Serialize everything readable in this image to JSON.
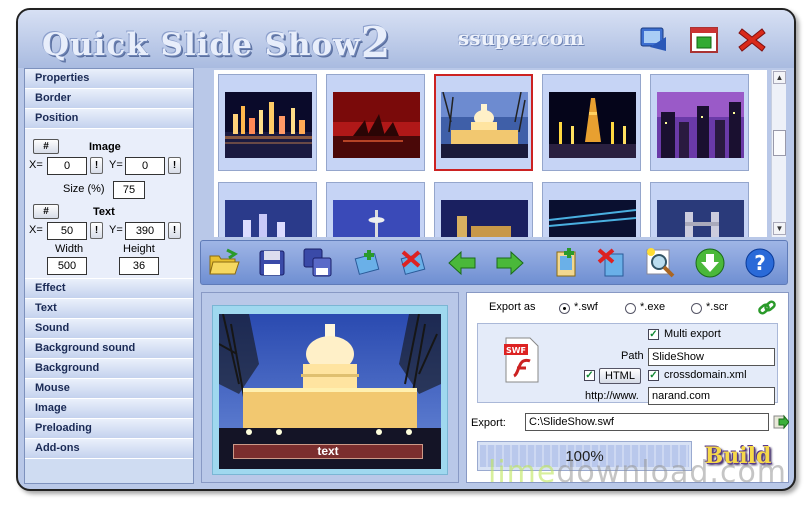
{
  "title": {
    "main": "Quick Slide Show",
    "version": "2",
    "site": "ssuper.com"
  },
  "sidebar": {
    "top_items": [
      {
        "label": "Properties"
      },
      {
        "label": "Border"
      },
      {
        "label": "Position"
      }
    ],
    "position_panel": {
      "image_title": "Image",
      "hash_label": "#",
      "x_label": "X=",
      "y_label": "Y=",
      "image_x": "0",
      "image_y": "0",
      "size_label": "Size (%)",
      "size_value": "75",
      "text_title": "Text",
      "text_x": "50",
      "text_y": "390",
      "width_label": "Width",
      "height_label": "Height",
      "width_value": "500",
      "height_value": "36",
      "excl": "!"
    },
    "bottom_items": [
      {
        "label": "Effect"
      },
      {
        "label": "Text"
      },
      {
        "label": "Sound"
      },
      {
        "label": "Background sound"
      },
      {
        "label": "Background"
      },
      {
        "label": "Mouse"
      },
      {
        "label": "Image"
      },
      {
        "label": "Preloading"
      },
      {
        "label": "Add-ons"
      }
    ]
  },
  "preview": {
    "caption": "text"
  },
  "export": {
    "export_as_label": "Export as",
    "formats": [
      "*.swf",
      "*.exe",
      "*.scr"
    ],
    "selected_format": "*.swf",
    "swf_badge": "SWF",
    "multi_export_label": "Multi export",
    "path_label": "Path",
    "path_value": "SlideShow",
    "html_button": "HTML",
    "crossdomain_label": "crossdomain.xml",
    "http_label": "http://www.",
    "http_value": "narand.com",
    "export_label": "Export:",
    "export_path": "C:\\SlideShow.swf",
    "progress_text": "100%",
    "progress_value": 1.0,
    "build_label": "Build"
  },
  "watermark": {
    "lime": "lime",
    "rest": "download.com"
  }
}
